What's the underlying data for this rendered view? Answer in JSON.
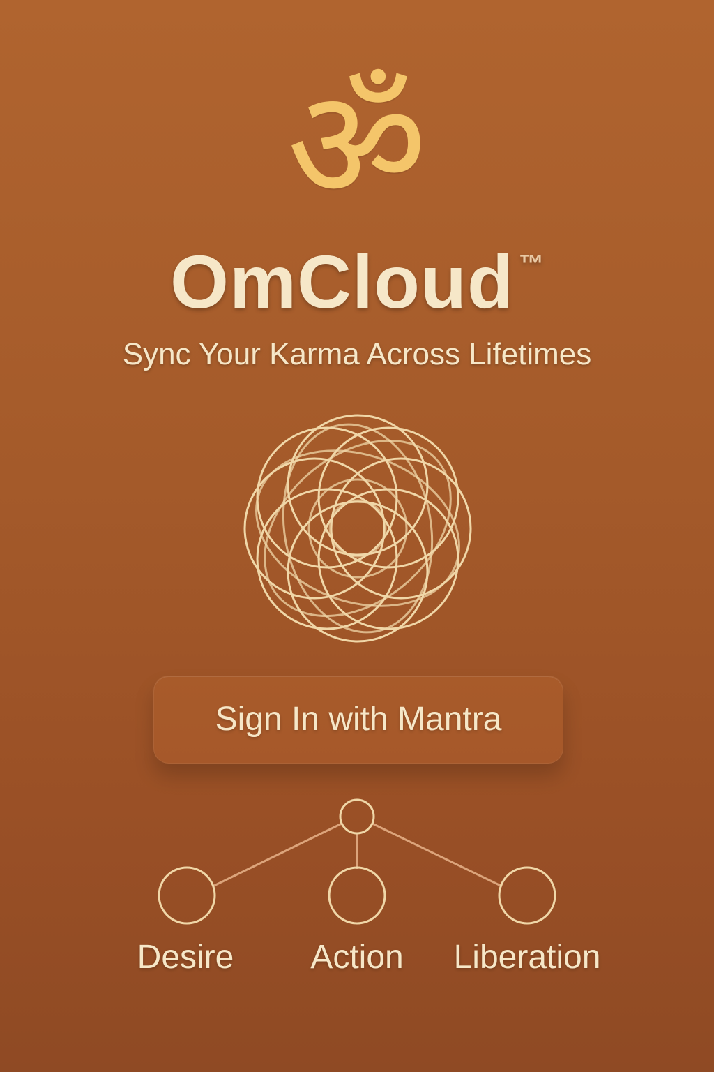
{
  "brand": {
    "om_symbol": "ॐ",
    "name": "OmCloud",
    "trademark": "™",
    "tagline": "Sync Your Karma Across Lifetimes"
  },
  "auth": {
    "sign_in_label": "Sign In with Mantra"
  },
  "cycle": {
    "nodes": [
      {
        "label": "Desire"
      },
      {
        "label": "Action"
      },
      {
        "label": "Liberation"
      }
    ]
  },
  "colors": {
    "background_top": "#B0642F",
    "background_bottom": "#8F4A24",
    "accent_gold": "#F4C56A",
    "text_cream": "#F6E7C8",
    "line_peach": "#E8B38A"
  },
  "icons": {
    "logo": "om-icon",
    "mandala": "mandala-icon"
  }
}
